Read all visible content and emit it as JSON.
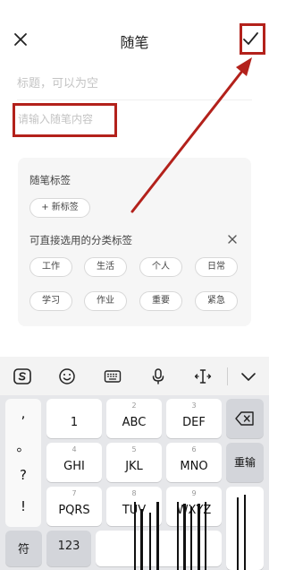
{
  "header": {
    "title": "随笔"
  },
  "editor": {
    "title_placeholder": "标题，可以为空",
    "content_placeholder": "请输入随笔内容"
  },
  "tags": {
    "section_label": "随笔标签",
    "new_tag_label": "+ 新标签",
    "category_label": "可直接选用的分类标签",
    "categories": [
      "工作",
      "生活",
      "个人",
      "日常",
      "学习",
      "作业",
      "重要",
      "紧急"
    ]
  },
  "keyboard": {
    "side_symbols": [
      ",",
      "。",
      "?",
      "!"
    ],
    "keys": [
      {
        "num": "",
        "label": "1"
      },
      {
        "num": "2",
        "label": "ABC"
      },
      {
        "num": "3",
        "label": "DEF"
      },
      {
        "num": "4",
        "label": "GHI"
      },
      {
        "num": "5",
        "label": "JKL"
      },
      {
        "num": "6",
        "label": "MNO"
      },
      {
        "num": "7",
        "label": "PQRS"
      },
      {
        "num": "8",
        "label": "TUV"
      },
      {
        "num": "9",
        "label": "WXYZ"
      }
    ],
    "enter_label": "重输",
    "symbol_label": "符",
    "numeric_label": "123"
  },
  "colors": {
    "annotation": "#b3211b",
    "panel_bg": "#f6f6f6",
    "keyboard_bg": "#e6e7ea"
  }
}
